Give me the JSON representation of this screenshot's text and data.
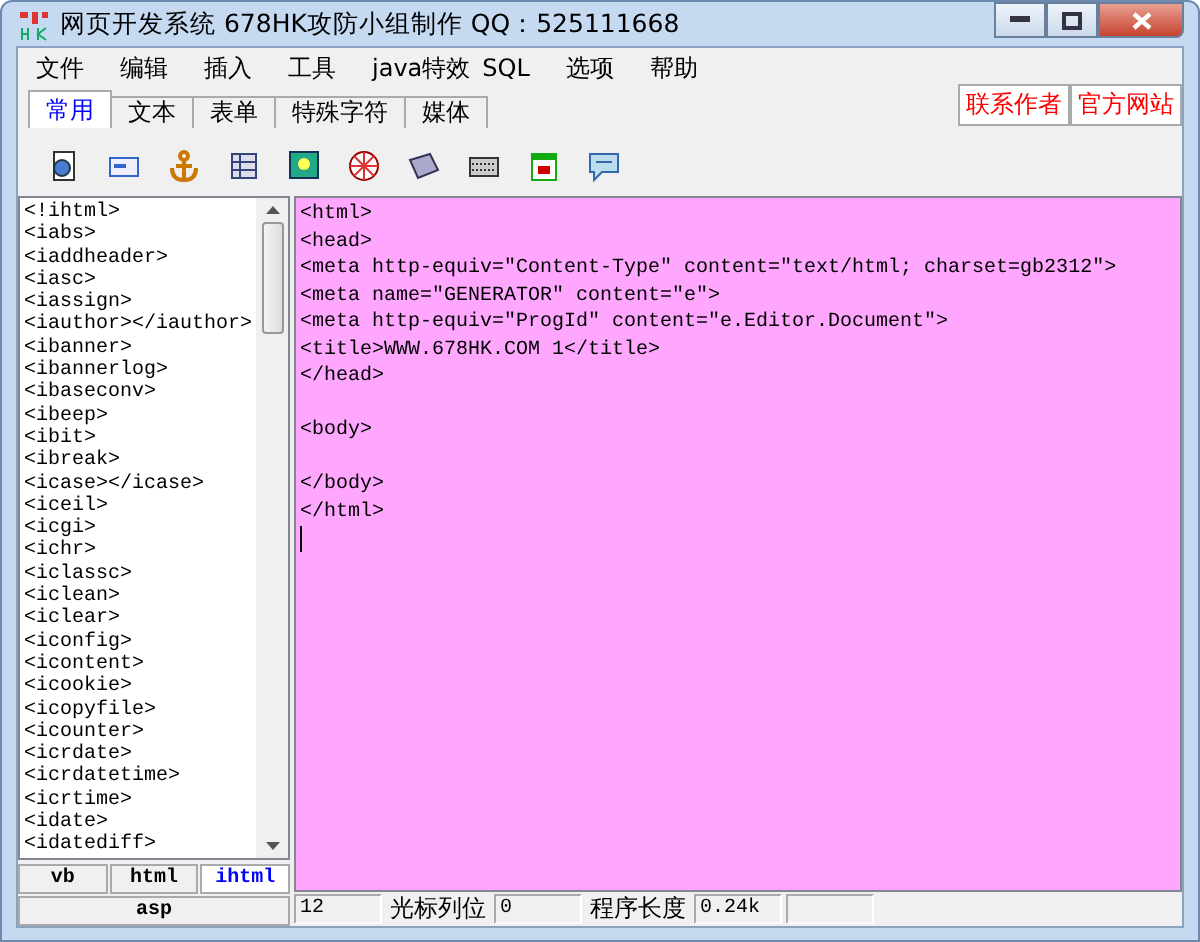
{
  "window": {
    "title": "网页开发系统 678HK攻防小组制作 QQ：525111668"
  },
  "menu": [
    "文件",
    "编辑",
    "插入",
    "工具",
    "java特效",
    "SQL",
    "选项",
    "帮助"
  ],
  "tabs": [
    {
      "label": "常用",
      "selected": true
    },
    {
      "label": "文本",
      "selected": false
    },
    {
      "label": "表单",
      "selected": false
    },
    {
      "label": "特殊字符",
      "selected": false
    },
    {
      "label": "媒体",
      "selected": false
    }
  ],
  "links": [
    "联系作者",
    "官方网站"
  ],
  "tag_list": {
    "items": [
      "<!ihtml>",
      "<iabs>",
      "<iaddheader>",
      "<iasc>",
      "<iassign>",
      "<iauthor></iauthor>",
      "<ibanner>",
      "<ibannerlog>",
      "<ibaseconv>",
      "<ibeep>",
      "<ibit>",
      "<ibreak>",
      "<icase></icase>",
      "<iceil>",
      "<icgi>",
      "<ichr>",
      "<iclassc>",
      "<iclean>",
      "<iclear>",
      "<iconfig>",
      "<icontent>",
      "<icookie>",
      "<icopyfile>",
      "<icounter>",
      "<icrdate>",
      "<icrdatetime>",
      "<icrtime>",
      "<idate>",
      "<idatediff>"
    ],
    "tabs": [
      {
        "label": "vb",
        "selected": false
      },
      {
        "label": "html",
        "selected": false
      },
      {
        "label": "ihtml",
        "selected": true
      },
      {
        "label": "asp",
        "selected": false
      }
    ]
  },
  "editor": {
    "lines": [
      {
        "kind": "code",
        "text": "<html>"
      },
      {
        "kind": "code",
        "text": "<head>"
      },
      {
        "kind": "code",
        "text": "<meta http-equiv=\"Content-Type\" content=\"text/html; charset=gb2312\">"
      },
      {
        "kind": "code",
        "text": "<meta name=\"GENERATOR\" content=\"e\">"
      },
      {
        "kind": "code",
        "text": "<meta http-equiv=\"ProgId\" content=\"e.Editor.Document\">"
      },
      {
        "kind": "code",
        "text": "<title>WWW.678HK.COM 1</title>"
      },
      {
        "kind": "code",
        "text": "</head>"
      },
      {
        "kind": "blank"
      },
      {
        "kind": "code",
        "text": "<body>"
      },
      {
        "kind": "blank"
      },
      {
        "kind": "code",
        "text": "</body>"
      },
      {
        "kind": "code",
        "text": "</html>"
      }
    ]
  },
  "status_bar": [
    {
      "kind": "value",
      "text": "12"
    },
    {
      "kind": "label",
      "text": "光标列位"
    },
    {
      "kind": "value",
      "text": "0"
    },
    {
      "kind": "label",
      "text": "程序长度"
    },
    {
      "kind": "value",
      "text": "0.24k"
    },
    {
      "kind": "value_empty"
    }
  ]
}
